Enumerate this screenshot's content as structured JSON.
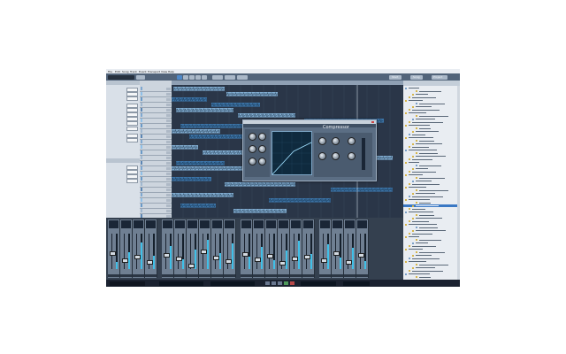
{
  "menu": [
    "File",
    "Edit",
    "Song",
    "Track",
    "Event",
    "Transport",
    "View",
    "Help"
  ],
  "toolbar": {
    "start_label": "Start",
    "song_label": "Song",
    "project_label": "Project"
  },
  "plugin": {
    "title": "Compressor"
  },
  "colors": {
    "accent": "#3fc0e8",
    "clip_blue": "#3f7fb8",
    "clip_light": "#8fc0e8",
    "background": "#1e2838"
  }
}
